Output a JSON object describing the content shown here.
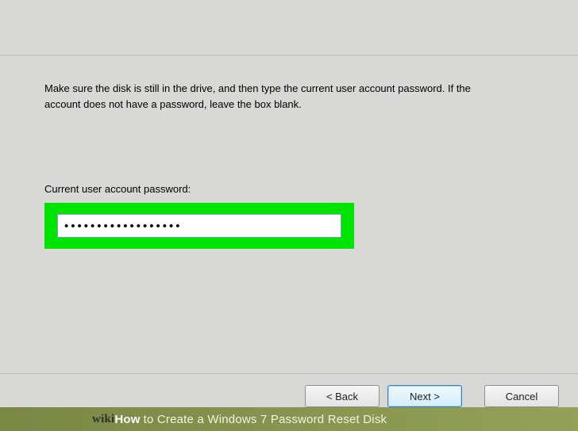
{
  "wizard": {
    "instruction": "Make sure the disk is still in the drive, and then type the current user account password. If the account does not have a password, leave the box blank.",
    "password_label": "Current user account password:",
    "password_value": "••••••••••••••••••",
    "buttons": {
      "back": "< Back",
      "next": "Next >",
      "cancel": "Cancel"
    }
  },
  "watermark": {
    "logo": "wiki",
    "how": "How",
    "title": " to Create a Windows 7 Password Reset Disk"
  }
}
